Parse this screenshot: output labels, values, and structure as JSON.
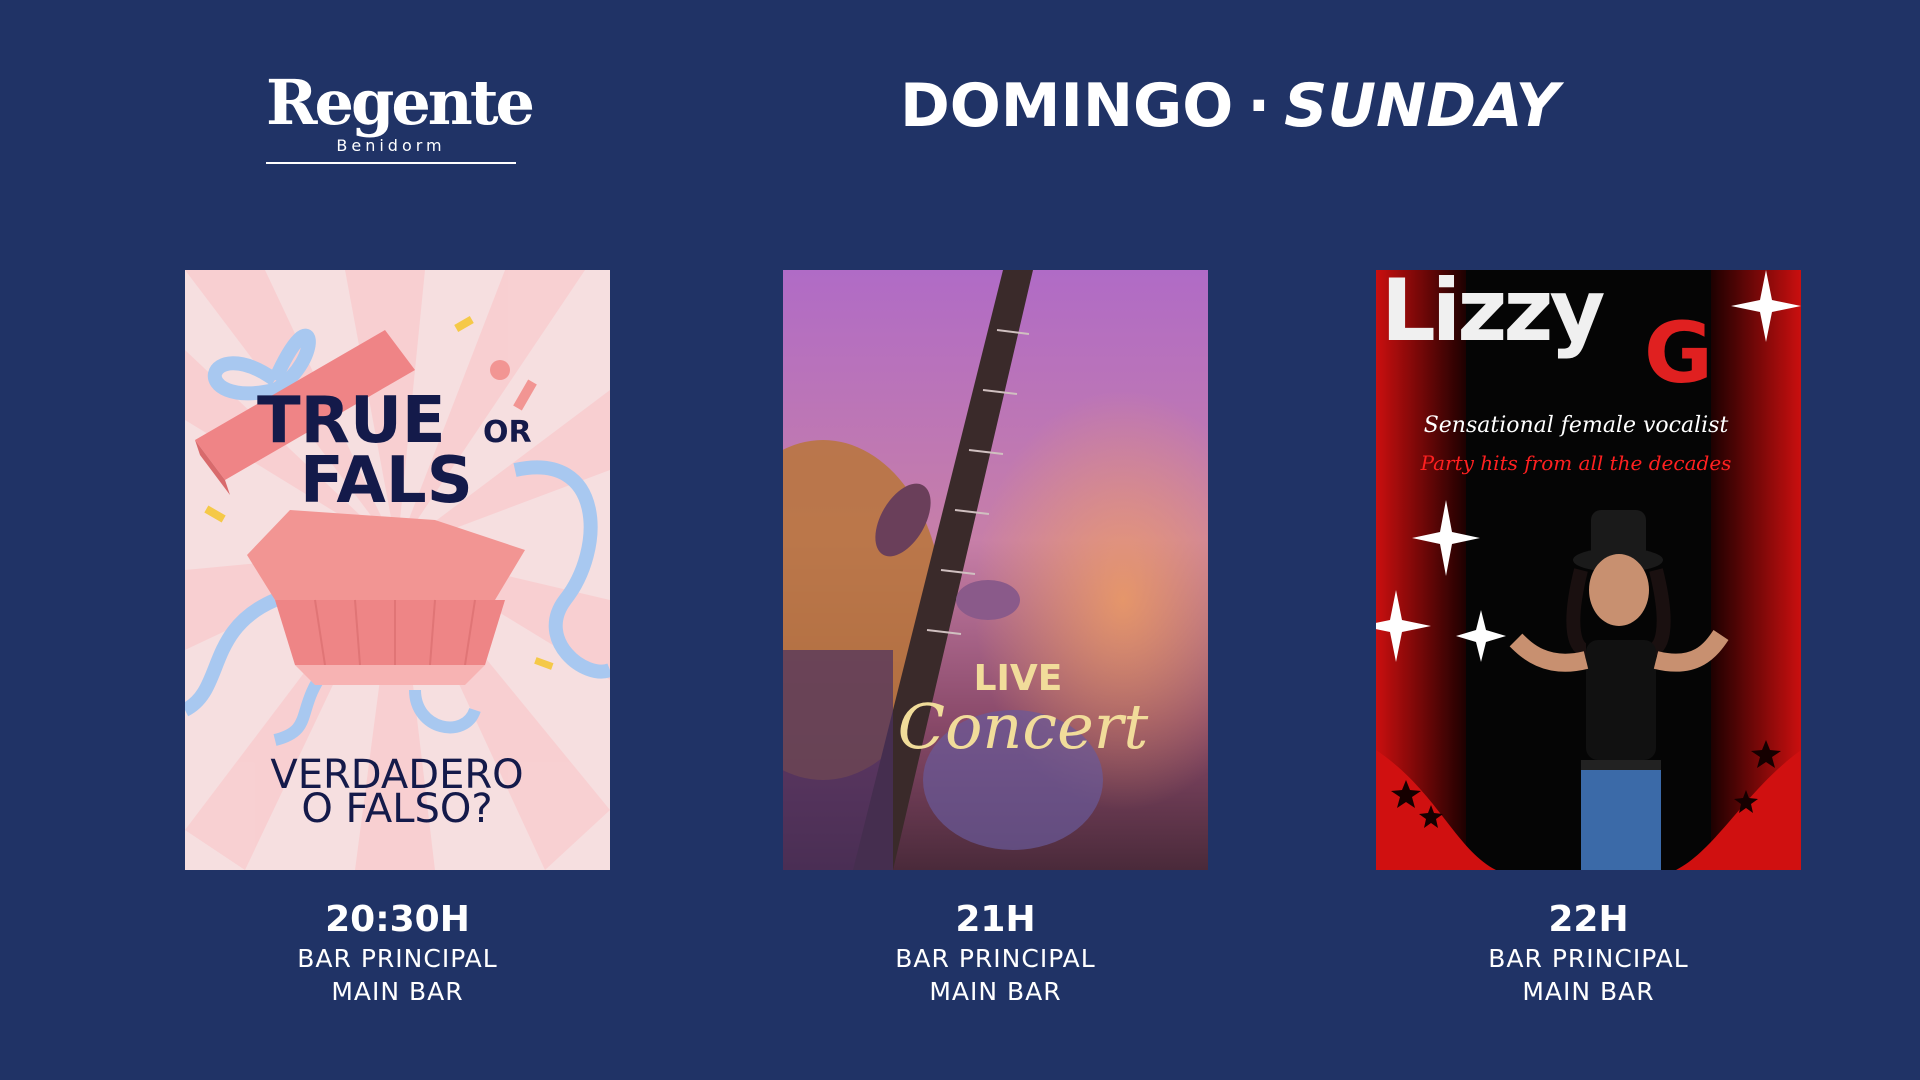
{
  "logo": {
    "name": "Regente",
    "location": "Benidorm"
  },
  "title": {
    "es": "DOMINGO",
    "separator": "·",
    "en": "SUNDAY"
  },
  "events": [
    {
      "poster": {
        "line1": "TRUE",
        "or": "OR",
        "line2": "FALS",
        "es_line1": "VERDADERO",
        "es_line2": "O FALSO?"
      },
      "time": "20:30H",
      "venue_es": "BAR PRINCIPAL",
      "venue_en": "MAIN BAR"
    },
    {
      "poster": {
        "line1": "LIVE",
        "line2": "Concert"
      },
      "time": "21H",
      "venue_es": "BAR PRINCIPAL",
      "venue_en": "MAIN BAR"
    },
    {
      "poster": {
        "name": "Lizzy",
        "initial": "G",
        "tagline": "Sensational female vocalist",
        "subline": "Party hits from all the decades"
      },
      "time": "22H",
      "venue_es": "BAR PRINCIPAL",
      "venue_en": "MAIN BAR"
    }
  ],
  "colors": {
    "background": "#203366",
    "accent_red": "#e02020",
    "gold": "#f1dc9a"
  }
}
